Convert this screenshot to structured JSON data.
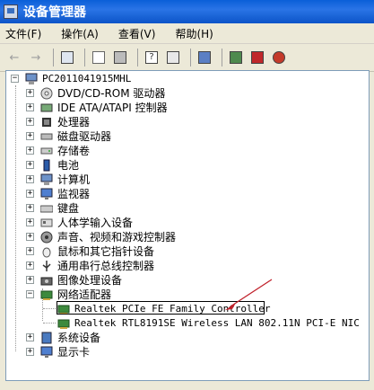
{
  "window": {
    "title": "设备管理器"
  },
  "menu": [
    "文件(F)",
    "操作(A)",
    "查看(V)",
    "帮助(H)"
  ],
  "toolbar": {
    "buttons": [
      "back-icon",
      "forward-icon",
      "show-hide-console-tree-icon",
      "properties-icon",
      "print-icon",
      "help-icon",
      "export-icon",
      "scan-hardware-icon",
      "update-driver-icon",
      "uninstall-icon",
      "disable-icon"
    ]
  },
  "tree": {
    "root": "PC2011041915MHL",
    "categories": [
      "DVD/CD-ROM 驱动器",
      "IDE ATA/ATAPI 控制器",
      "处理器",
      "磁盘驱动器",
      "存储卷",
      "电池",
      "计算机",
      "监视器",
      "键盘",
      "人体学输入设备",
      "声音、视频和游戏控制器",
      "鼠标和其它指针设备",
      "通用串行总线控制器",
      "图像处理设备",
      "网络适配器"
    ],
    "network_children": [
      "Realtek PCIe FE Family Controller",
      "Realtek RTL8191SE Wireless LAN 802.11N PCI-E NIC"
    ],
    "after": [
      "系统设备",
      "显示卡"
    ]
  }
}
